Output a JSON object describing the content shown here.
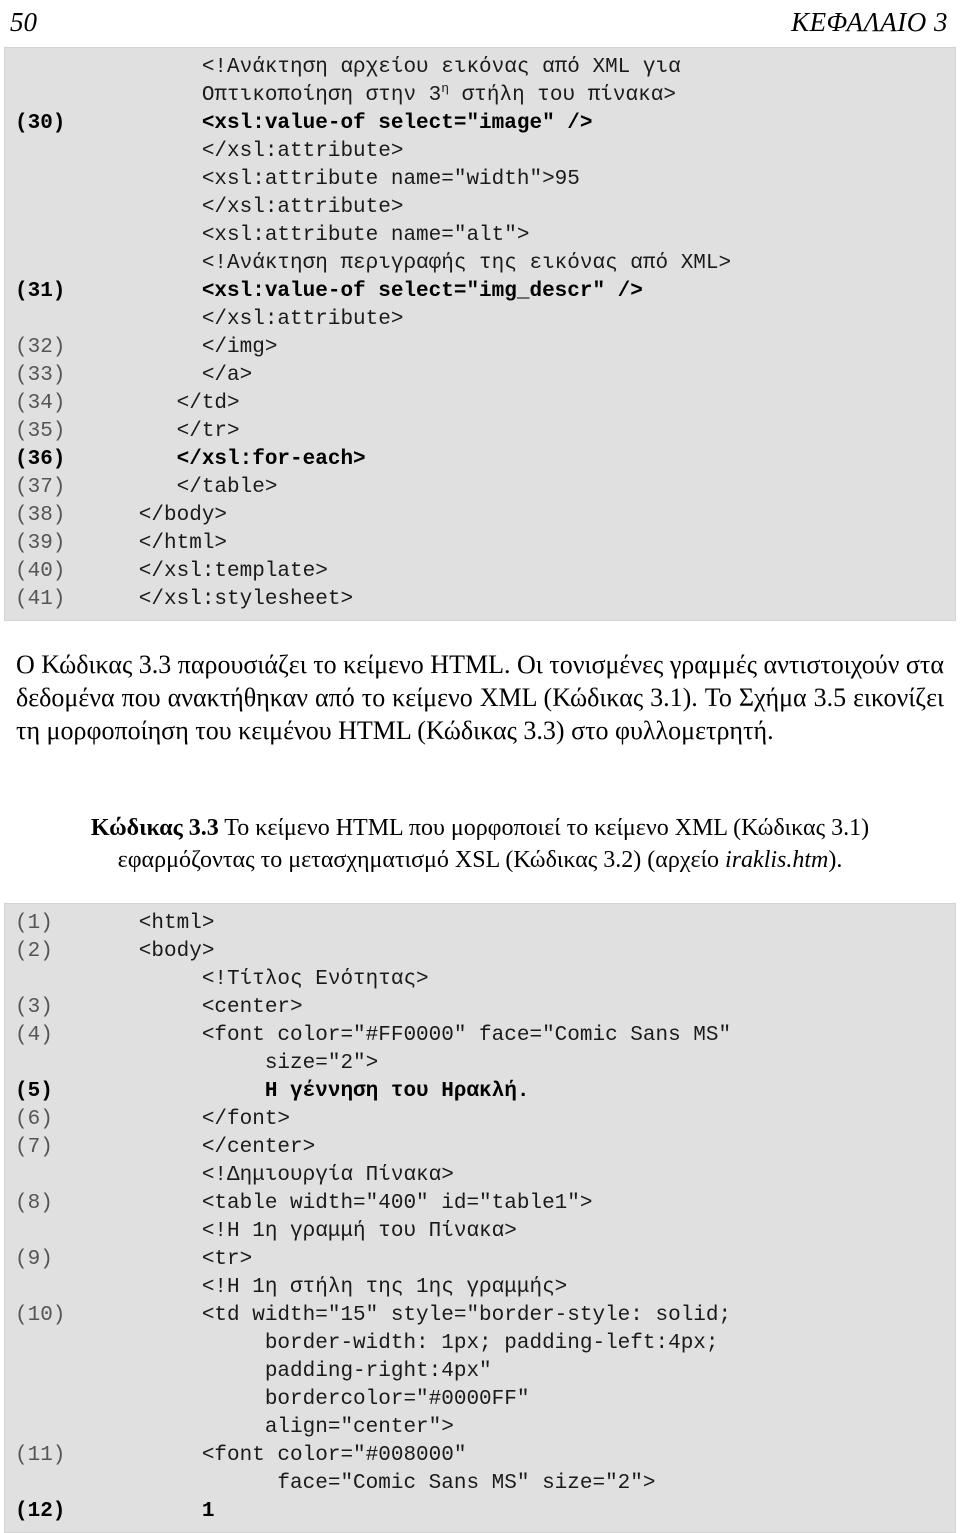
{
  "header": {
    "page_number": "50",
    "chapter_label": "ΚΕΦΑΛΑΙΟ 3"
  },
  "listing_top": {
    "lines": [
      {
        "num": "",
        "code": "        <!Ανάκτηση αρχείου εικόνας από XML για",
        "highlight": false
      },
      {
        "num": "",
        "code": "        Οπτικοποίηση στην 3η στήλη του πίνακα>",
        "highlight": false,
        "sup": "η"
      },
      {
        "num": "(30)",
        "code": "        <xsl:value-of select=\"image\" />",
        "highlight": true
      },
      {
        "num": "",
        "code": "        </xsl:attribute>",
        "highlight": false
      },
      {
        "num": "",
        "code": "        <xsl:attribute name=\"width\">95",
        "highlight": false
      },
      {
        "num": "",
        "code": "        </xsl:attribute>",
        "highlight": false
      },
      {
        "num": "",
        "code": "        <xsl:attribute name=\"alt\">",
        "highlight": false
      },
      {
        "num": "",
        "code": "        <!Ανάκτηση περιγραφής της εικόνας από XML>",
        "highlight": false
      },
      {
        "num": "(31)",
        "code": "        <xsl:value-of select=\"img_descr\" />",
        "highlight": true
      },
      {
        "num": "",
        "code": "        </xsl:attribute>",
        "highlight": false
      },
      {
        "num": "(32)",
        "code": "        </img>",
        "highlight": false
      },
      {
        "num": "(33)",
        "code": "        </a>",
        "highlight": false
      },
      {
        "num": "(34)",
        "code": "      </td>",
        "highlight": false
      },
      {
        "num": "(35)",
        "code": "      </tr>",
        "highlight": false
      },
      {
        "num": "(36)",
        "code": "      </xsl:for-each>",
        "highlight": true
      },
      {
        "num": "(37)",
        "code": "      </table>",
        "highlight": false
      },
      {
        "num": "(38)",
        "code": "   </body>",
        "highlight": false
      },
      {
        "num": "(39)",
        "code": "   </html>",
        "highlight": false
      },
      {
        "num": "(40)",
        "code": "   </xsl:template>",
        "highlight": false
      },
      {
        "num": "(41)",
        "code": "   </xsl:stylesheet>",
        "highlight": false
      }
    ]
  },
  "paragraph_main": "Ο Κώδικας 3.3 παρουσιάζει το κείμενο HTML. Οι τονισμένες γραμμές αντιστοιχούν στα δεδομένα που ανακτήθηκαν από το κείμενο XML (Κώδικας 3.1). Το Σχήμα 3.5 εικονίζει τη μορφοποίηση του κειμένου HTML (Κώδικας 3.3) στο φυλλομετρητή.",
  "caption": {
    "label": "Κώδικας 3.3",
    "text_before_file": " Το κείμενο HTML που μορφοποιεί το κείμενο XML (Κώδικας 3.1) εφαρμόζοντας το μετασχηματισμό XSL (Κώδικας 3.2) (αρχείο ",
    "file_name": "iraklis.htm",
    "text_after_file": ")."
  },
  "listing_bottom": {
    "lines": [
      {
        "num": "(1)",
        "code": "   <html>",
        "highlight": false
      },
      {
        "num": "(2)",
        "code": "   <body>",
        "highlight": false
      },
      {
        "num": "",
        "code": "        <!Τίτλος Ενότητας>",
        "highlight": false
      },
      {
        "num": "(3)",
        "code": "        <center>",
        "highlight": false
      },
      {
        "num": "(4)",
        "code": "        <font color=\"#FF0000\" face=\"Comic Sans MS\"",
        "highlight": false
      },
      {
        "num": "",
        "code": "             size=\"2\">",
        "highlight": false
      },
      {
        "num": "(5)",
        "code": "             Η γέννηση του Ηρακλή.",
        "highlight": true
      },
      {
        "num": "(6)",
        "code": "        </font>",
        "highlight": false
      },
      {
        "num": "(7)",
        "code": "        </center>",
        "highlight": false
      },
      {
        "num": "",
        "code": "        <!Δημιουργία Πίνακα>",
        "highlight": false
      },
      {
        "num": "(8)",
        "code": "        <table width=\"400\" id=\"table1\">",
        "highlight": false
      },
      {
        "num": "",
        "code": "        <!Η 1η γραμμή του Πίνακα>",
        "highlight": false
      },
      {
        "num": "(9)",
        "code": "        <tr>",
        "highlight": false
      },
      {
        "num": "",
        "code": "        <!Η 1η στήλη της 1ης γραμμής>",
        "highlight": false
      },
      {
        "num": "(10)",
        "code": "        <td width=\"15\" style=\"border-style: solid;",
        "highlight": false
      },
      {
        "num": "",
        "code": "             border-width: 1px; padding-left:4px;",
        "highlight": false
      },
      {
        "num": "",
        "code": "             padding-right:4px\"",
        "highlight": false
      },
      {
        "num": "",
        "code": "             bordercolor=\"#0000FF\"",
        "highlight": false
      },
      {
        "num": "",
        "code": "             align=\"center\">",
        "highlight": false
      },
      {
        "num": "(11)",
        "code": "        <font color=\"#008000\"",
        "highlight": false
      },
      {
        "num": "",
        "code": "              face=\"Comic Sans MS\" size=\"2\">",
        "highlight": false
      },
      {
        "num": "(12)",
        "code": "        1",
        "highlight": true
      }
    ]
  },
  "colors": {
    "code_background": "#e0e0e0",
    "code_border": "#d4d4d4",
    "line_number": "#555555",
    "text": "#000000",
    "page_background": "#ffffff"
  }
}
